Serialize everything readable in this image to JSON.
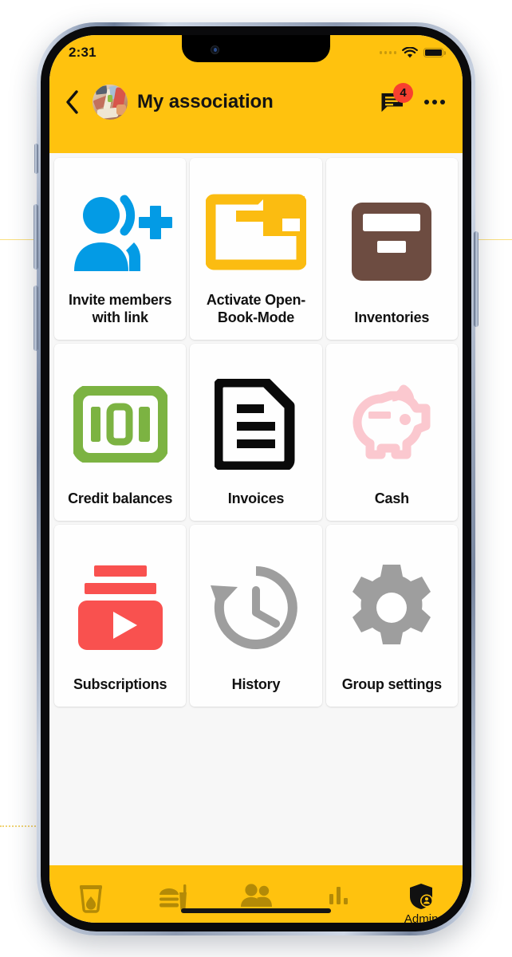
{
  "status_bar": {
    "clock": "2:31",
    "signal_icon": "signal-dots-icon",
    "wifi_icon": "wifi-icon",
    "battery_icon": "battery-full-icon"
  },
  "app_bar": {
    "back_icon": "back-chevron-icon",
    "avatar_icon": "group-avatar-photo",
    "title": "My association",
    "messages_icon": "chat-bubble-icon",
    "messages_badge": "4",
    "overflow_icon": "more-horizontal-icon"
  },
  "theme": {
    "brand_yellow": "#FFC20E",
    "badge_red": "#F8402F",
    "tile_bg": "#FEFEFE",
    "body_bg": "#F7F7F7"
  },
  "grid": {
    "tiles": [
      {
        "label": "Invite members with link",
        "icon": "person-add-voice-icon",
        "color": "#039BE5"
      },
      {
        "label": "Activate Open-Book-Mode",
        "icon": "folder-open-icon",
        "color": "#FBBC11"
      },
      {
        "label": "Inventories",
        "icon": "archive-box-icon",
        "color": "#6D4C41"
      },
      {
        "label": "Credit balances",
        "icon": "banknote-100-icon",
        "color": "#7CB342"
      },
      {
        "label": "Invoices",
        "icon": "document-lines-icon",
        "color": "#0A0A0A"
      },
      {
        "label": "Cash",
        "icon": "piggy-bank-icon",
        "color": "#FBC8CF"
      },
      {
        "label": "Subscriptions",
        "icon": "subscriptions-play-icon",
        "color": "#F9514F"
      },
      {
        "label": "History",
        "icon": "history-clock-icon",
        "color": "#9E9E9E"
      },
      {
        "label": "Group settings",
        "icon": "gear-icon",
        "color": "#9E9E9E"
      }
    ]
  },
  "bottom_nav": {
    "items": [
      {
        "label": "",
        "icon": "drink-cup-icon",
        "active": false
      },
      {
        "label": "",
        "icon": "fastfood-icon",
        "active": false
      },
      {
        "label": "",
        "icon": "people-group-icon",
        "active": false
      },
      {
        "label": "",
        "icon": "bar-chart-icon",
        "active": false
      },
      {
        "label": "Admin",
        "icon": "admin-shield-person-icon",
        "active": true
      }
    ]
  }
}
